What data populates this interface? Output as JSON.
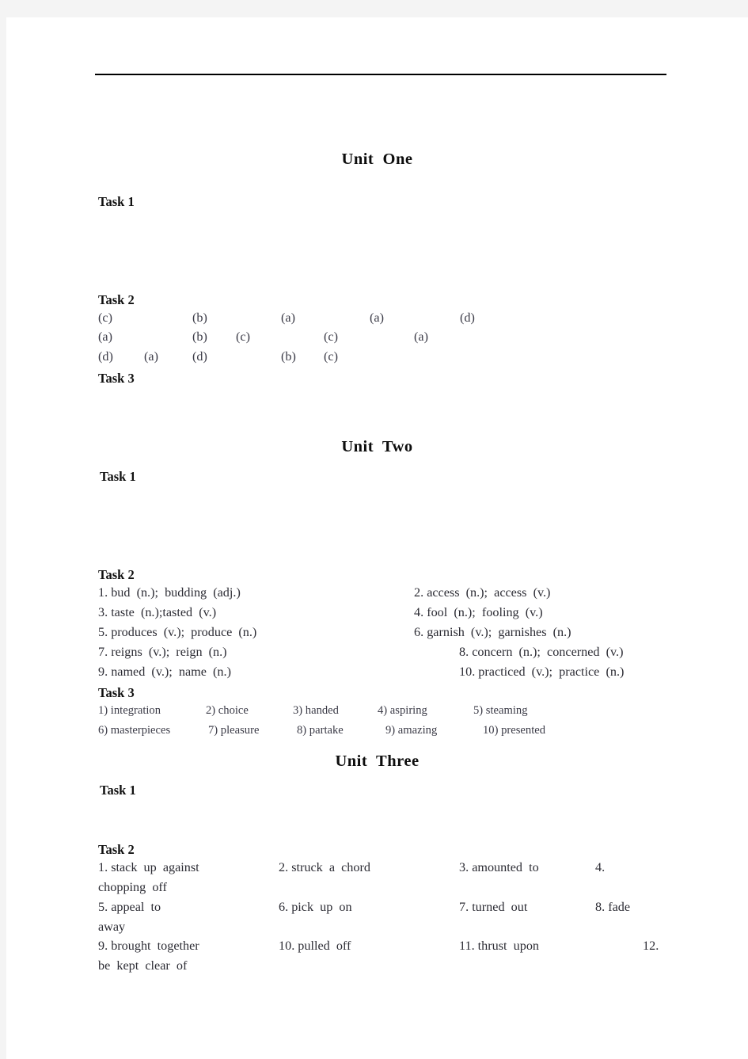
{
  "document": {
    "page_background": "#ffffff",
    "canvas_background": "#f4f4f4",
    "rule_color": "#000000"
  },
  "units": [
    {
      "heading": "Unit  One",
      "tasks": [
        {
          "label": "Task 1"
        },
        {
          "label": "Task 2"
        },
        {
          "label": "Task 3"
        }
      ],
      "task2_rows": [
        [
          "(c)",
          "(b)",
          "(a)",
          "(a)",
          "(d)"
        ],
        [
          "(a)",
          "(b)",
          "(c)",
          "(c)",
          "(a)"
        ],
        [
          "(d)",
          "(a)",
          "(d)",
          "(b)",
          "(c)"
        ]
      ]
    },
    {
      "heading": "Unit  Two",
      "tasks": [
        {
          "label": "Task 1"
        },
        {
          "label": "Task 2"
        },
        {
          "label": "Task 3"
        }
      ],
      "task2_items": [
        "1. bud  (n.);  budding  (adj.)",
        "2. access  (n.);  access  (v.)",
        "3. taste  (n.);tasted  (v.)",
        "4. fool  (n.);  fooling  (v.)",
        "5. produces  (v.);  produce  (n.)",
        "6. garnish  (v.);  garnishes  (n.)",
        "7. reigns  (v.);  reign  (n.)",
        "8. concern  (n.);  concerned  (v.)",
        "9. named  (v.);  name  (n.)",
        "10. practiced  (v.);  practice  (n.)"
      ],
      "task3_items": [
        "1) integration",
        "2) choice",
        "3) handed",
        "4) aspiring",
        "5) steaming",
        "6) masterpieces",
        "7) pleasure",
        "8) partake",
        "9) amazing",
        "10) presented"
      ]
    },
    {
      "heading": "Unit  Three",
      "tasks": [
        {
          "label": "Task 1"
        },
        {
          "label": "Task 2"
        }
      ],
      "task2_items": [
        "1. stack  up  against",
        "2. struck  a  chord",
        "3. amounted  to",
        "4.",
        "chopping  off",
        "5. appeal  to",
        "6. pick  up  on",
        "7. turned  out",
        "8. fade",
        "away",
        "9. brought  together",
        "10. pulled  off",
        "11. thrust  upon",
        "12.",
        "be  kept  clear  of"
      ]
    }
  ]
}
